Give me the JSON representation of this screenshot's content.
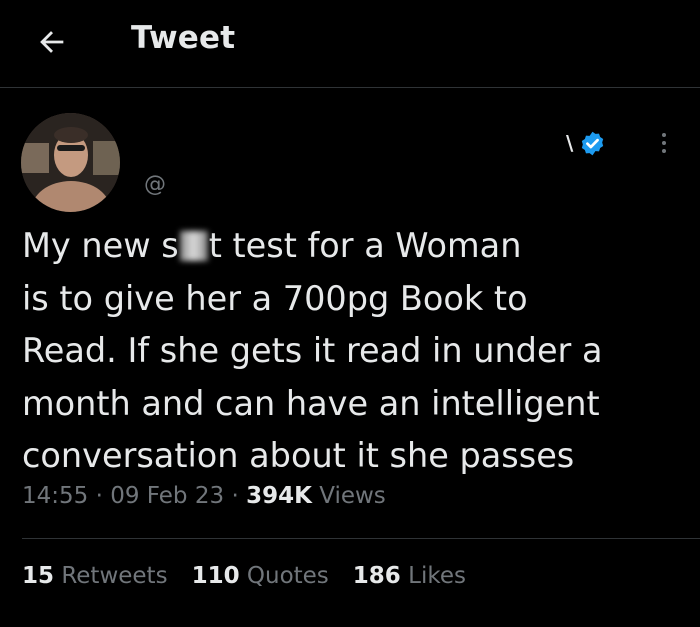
{
  "header": {
    "title": "Tweet"
  },
  "tweet": {
    "handle": "@",
    "name_fragment": "\\",
    "text_lines": [
      [
        "My new s",
        "t test for a Woman"
      ],
      "is to give her a 700pg Book to",
      "Read.  If she gets it read in under a",
      "month and can have an intelligent",
      "conversation about it she passes"
    ],
    "time": "14:55",
    "date": "09 Feb 23",
    "views_count": "394K",
    "views_label": "Views",
    "separator": "·"
  },
  "stats": {
    "retweets_count": "15",
    "retweets_label": "Retweets",
    "quotes_count": "110",
    "quotes_label": "Quotes",
    "likes_count": "186",
    "likes_label": "Likes"
  },
  "colors": {
    "background": "#000000",
    "text": "#e7e9ea",
    "secondary": "#71767b",
    "verified": "#1d9bf0",
    "border": "#2f3336"
  },
  "icons": {
    "back": "arrow-left-icon",
    "verified": "verified-badge-icon",
    "more": "more-vertical-icon"
  }
}
